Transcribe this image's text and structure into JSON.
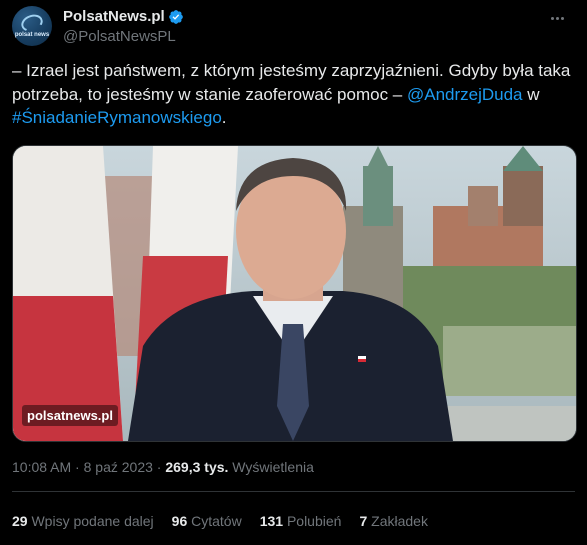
{
  "author": {
    "display_name": "PolsatNews.pl",
    "handle": "@PolsatNewsPL",
    "avatar_text": "polsat news"
  },
  "tweet": {
    "text_before": "– Izrael jest państwem, z którym jesteśmy zaprzyjaźnieni. Gdyby była taka potrzeba, to jesteśmy w stanie zaoferować pomoc – ",
    "mention": "@AndrzejDuda",
    "text_mid": " w ",
    "hashtag": "#ŚniadanieRymanowskiego",
    "text_end": "."
  },
  "media": {
    "watermark": "polsatnews.pl"
  },
  "meta": {
    "time": "10:08 AM",
    "sep1": " · ",
    "date": "8 paź 2023",
    "sep2": " · ",
    "views_count": "269,3 tys.",
    "views_label": " Wyświetlenia"
  },
  "stats": {
    "reposts_count": "29",
    "reposts_label": " Wpisy podane dalej",
    "quotes_count": "96",
    "quotes_label": " Cytatów",
    "likes_count": "131",
    "likes_label": " Polubień",
    "bookmarks_count": "7",
    "bookmarks_label": " Zakładek"
  },
  "colors": {
    "accent": "#1d9bf0",
    "background": "#000000",
    "secondary_text": "#71767b"
  },
  "icons": {
    "verified": "verified-badge-icon",
    "more": "more-options-icon"
  }
}
